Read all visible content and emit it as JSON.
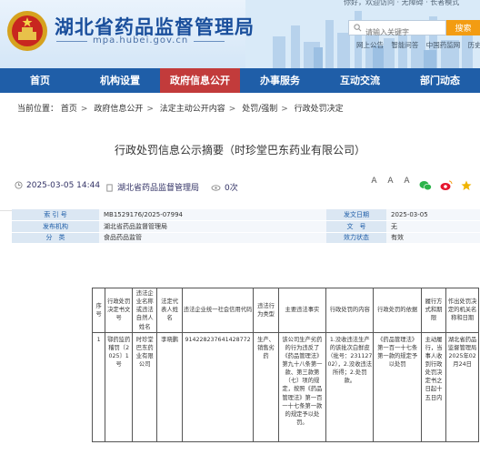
{
  "header": {
    "title": "湖北省药品监督管理局",
    "domain": "mpa.hubei.gov.cn",
    "top_links": "你好，欢迎访问  ·  无障碍  ·  长者模式",
    "search_placeholder": "请输入关键字",
    "search_label": "搜索",
    "sub_links": [
      "网上公告",
      "智能问答",
      "中国药监网",
      "历史版本"
    ]
  },
  "nav": [
    {
      "label": "首页"
    },
    {
      "label": "机构设置"
    },
    {
      "label": "政府信息公开"
    },
    {
      "label": "办事服务"
    },
    {
      "label": "互动交流"
    },
    {
      "label": "部门动态"
    }
  ],
  "breadcrumb": {
    "label": "当前位置：",
    "items": [
      "首页",
      "政府信息公开",
      "法定主动公开内容",
      "处罚/强制",
      "行政处罚决定"
    ]
  },
  "doc": {
    "title": "行政处罚信息公示摘要（时珍堂巴东药业有限公司）",
    "date": "2025-03-05 14:44",
    "source": "湖北省药品监督管理局",
    "views": "0次",
    "font_sizes": [
      "A",
      "A",
      "A"
    ]
  },
  "info": {
    "index_label": "索 引 号",
    "index_value": "MB1529176/2025-07994",
    "category_label": "发文日期",
    "category_value": "2025-03-05",
    "org_label": "发布机构",
    "org_value": "湖北省药品监督管理局",
    "docno_label": "文　号",
    "docno_value": "无",
    "class_label": "分　类",
    "class_value": "食品药品监管",
    "status_label": "效力状态",
    "status_value": "有效"
  },
  "table": {
    "headers": [
      "序号",
      "行政处罚决定书文号",
      "违法企业名称或违法自然人姓名",
      "法定代表人姓名",
      "违法企业统一社会信用代码",
      "违法行为类型",
      "主要违法事实",
      "行政处罚的内容",
      "行政处罚的依据",
      "履行方式和期限",
      "作出处罚决定的机关名称和日期"
    ],
    "rows": [
      [
        "1",
        "鄂药监药稽罚〔2025〕1号",
        "时珍堂巴东药业有限公司",
        "李晓鹏",
        "914228237641428772",
        "生产、销售劣药",
        "该公司生产劣药的行为违反了《药品管理法》第九十八条第一款、第三款第（七）项的规定，按照《药品管理法》第一百一十七条第一款的规定予以处罚。",
        "1.没收违法生产的该批次白鲜皮（批号：23112702），2.没收违法所得；2.处罚款。",
        "《药品管理法》第一百一十七条第一款的规定予以处罚",
        "主动履行，当事人收到行政处罚决定书之日起十五日内",
        "湖北省药品监督管理局2025年02月24日"
      ]
    ]
  },
  "colors": {
    "nav": "#1f5ea8",
    "nav_active": "#c23b3b",
    "title": "#1a4f9c",
    "search": "#f39c12"
  }
}
